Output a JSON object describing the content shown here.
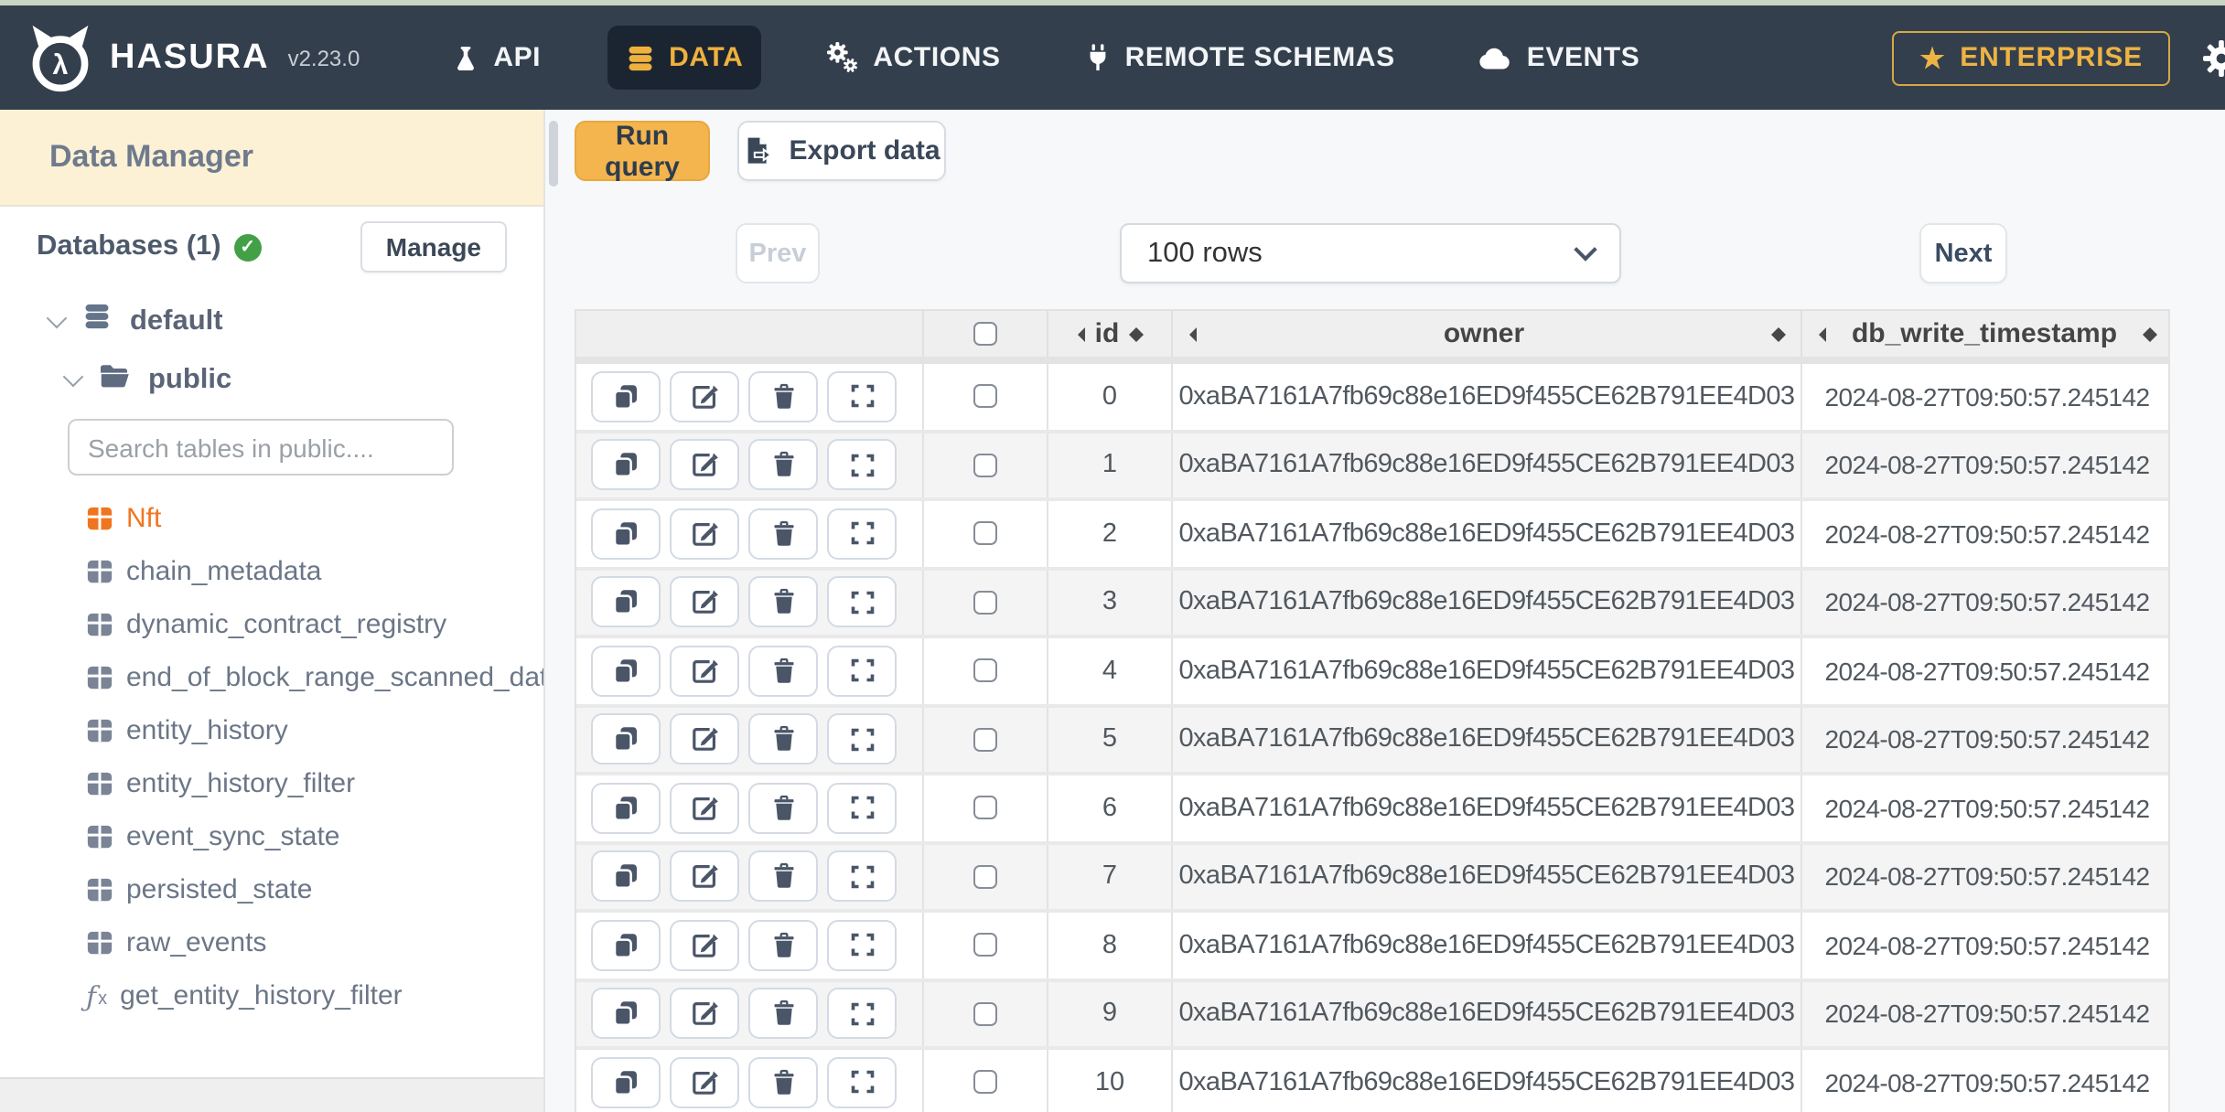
{
  "navbar": {
    "brand": "HASURA",
    "version": "v2.23.0",
    "items": [
      {
        "label": "API",
        "icon": "flask-icon",
        "active": false
      },
      {
        "label": "DATA",
        "icon": "database-icon",
        "active": true
      },
      {
        "label": "ACTIONS",
        "icon": "gears-icon",
        "active": false
      },
      {
        "label": "REMOTE SCHEMAS",
        "icon": "plug-icon",
        "active": false
      },
      {
        "label": "EVENTS",
        "icon": "cloud-icon",
        "active": false
      }
    ],
    "enterprise_label": "ENTERPRISE"
  },
  "sidebar": {
    "title": "Data Manager",
    "databases_label": "Databases (1)",
    "manage_label": "Manage",
    "tree": {
      "database": "default",
      "schema": "public",
      "search_placeholder": "Search tables in public....",
      "items": [
        {
          "label": "Nft",
          "type": "table",
          "highlighted": true
        },
        {
          "label": "chain_metadata",
          "type": "table",
          "highlighted": false
        },
        {
          "label": "dynamic_contract_registry",
          "type": "table",
          "highlighted": false
        },
        {
          "label": "end_of_block_range_scanned_data",
          "type": "table",
          "highlighted": false
        },
        {
          "label": "entity_history",
          "type": "table",
          "highlighted": false
        },
        {
          "label": "entity_history_filter",
          "type": "table",
          "highlighted": false
        },
        {
          "label": "event_sync_state",
          "type": "table",
          "highlighted": false
        },
        {
          "label": "persisted_state",
          "type": "table",
          "highlighted": false
        },
        {
          "label": "raw_events",
          "type": "table",
          "highlighted": false
        },
        {
          "label": "get_entity_history_filter",
          "type": "function",
          "highlighted": false
        }
      ]
    }
  },
  "toolbar": {
    "run_query_label": "Run query",
    "export_label": "Export data"
  },
  "pagination": {
    "prev_label": "Prev",
    "rows_selected": "100 rows",
    "next_label": "Next"
  },
  "table": {
    "columns": [
      {
        "key": "id",
        "label": "id"
      },
      {
        "key": "owner",
        "label": "owner"
      },
      {
        "key": "db_write_timestamp",
        "label": "db_write_timestamp"
      }
    ],
    "rows": [
      {
        "id": "0",
        "owner": "0xaBA7161A7fb69c88e16ED9f455CE62B791EE4D03",
        "db_write_timestamp": "2024-08-27T09:50:57.245142"
      },
      {
        "id": "1",
        "owner": "0xaBA7161A7fb69c88e16ED9f455CE62B791EE4D03",
        "db_write_timestamp": "2024-08-27T09:50:57.245142"
      },
      {
        "id": "2",
        "owner": "0xaBA7161A7fb69c88e16ED9f455CE62B791EE4D03",
        "db_write_timestamp": "2024-08-27T09:50:57.245142"
      },
      {
        "id": "3",
        "owner": "0xaBA7161A7fb69c88e16ED9f455CE62B791EE4D03",
        "db_write_timestamp": "2024-08-27T09:50:57.245142"
      },
      {
        "id": "4",
        "owner": "0xaBA7161A7fb69c88e16ED9f455CE62B791EE4D03",
        "db_write_timestamp": "2024-08-27T09:50:57.245142"
      },
      {
        "id": "5",
        "owner": "0xaBA7161A7fb69c88e16ED9f455CE62B791EE4D03",
        "db_write_timestamp": "2024-08-27T09:50:57.245142"
      },
      {
        "id": "6",
        "owner": "0xaBA7161A7fb69c88e16ED9f455CE62B791EE4D03",
        "db_write_timestamp": "2024-08-27T09:50:57.245142"
      },
      {
        "id": "7",
        "owner": "0xaBA7161A7fb69c88e16ED9f455CE62B791EE4D03",
        "db_write_timestamp": "2024-08-27T09:50:57.245142"
      },
      {
        "id": "8",
        "owner": "0xaBA7161A7fb69c88e16ED9f455CE62B791EE4D03",
        "db_write_timestamp": "2024-08-27T09:50:57.245142"
      },
      {
        "id": "9",
        "owner": "0xaBA7161A7fb69c88e16ED9f455CE62B791EE4D03",
        "db_write_timestamp": "2024-08-27T09:50:57.245142"
      },
      {
        "id": "10",
        "owner": "0xaBA7161A7fb69c88e16ED9f455CE62B791EE4D03",
        "db_write_timestamp": "2024-08-27T09:50:57.245142"
      }
    ]
  },
  "accents": {
    "navbar_bg": "#333f4d",
    "active_tab_bg": "#1b2431",
    "brand_gold": "#eeb13e",
    "run_query_yellow": "#f4b54f",
    "nft_orange": "#f0751f",
    "header_cream": "#fcf1d4",
    "check_green": "#43a047"
  }
}
